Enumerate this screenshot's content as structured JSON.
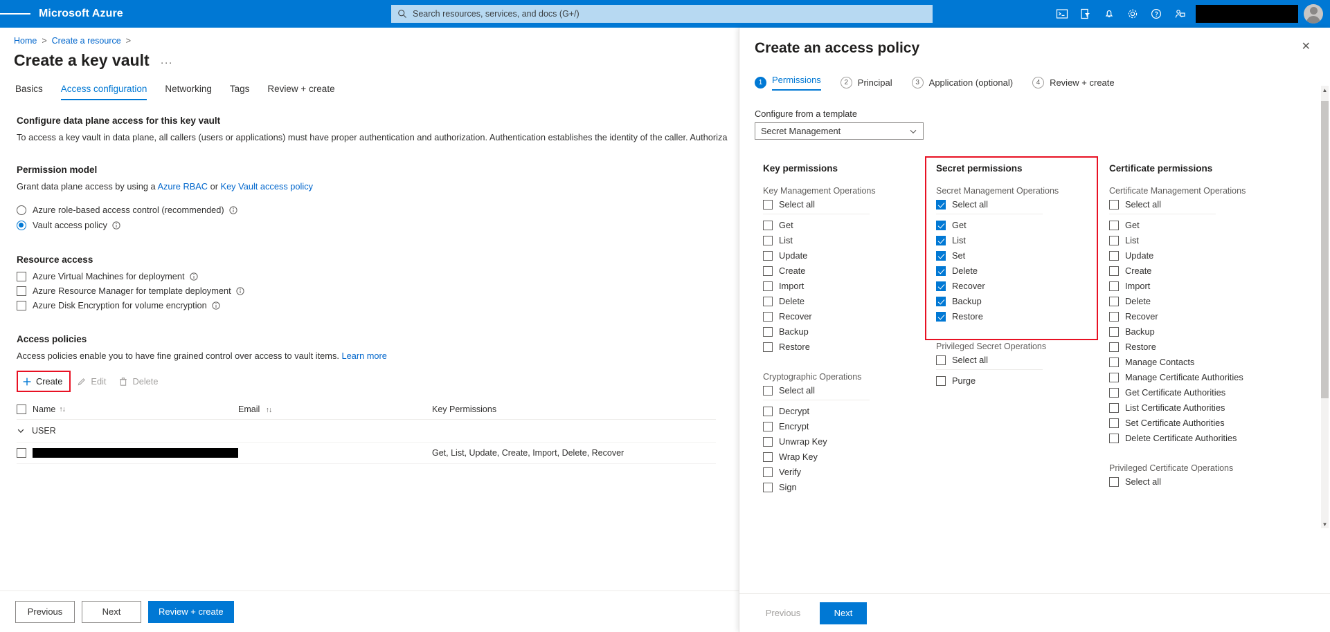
{
  "topbar": {
    "brand": "Microsoft Azure",
    "search_placeholder": "Search resources, services, and docs (G+/)",
    "icons": [
      {
        "name": "cloud-shell-icon"
      },
      {
        "name": "directory-filter-icon"
      },
      {
        "name": "notifications-bell-icon"
      },
      {
        "name": "settings-gear-icon"
      },
      {
        "name": "help-question-icon"
      },
      {
        "name": "feedback-smiley-icon"
      }
    ]
  },
  "breadcrumb": {
    "home": "Home",
    "create_resource": "Create a resource",
    "separator": ">"
  },
  "page": {
    "title": "Create a key vault",
    "ellipsis": "···"
  },
  "tabs": [
    {
      "label": "Basics",
      "active": false
    },
    {
      "label": "Access configuration",
      "active": true
    },
    {
      "label": "Networking",
      "active": false
    },
    {
      "label": "Tags",
      "active": false
    },
    {
      "label": "Review + create",
      "active": false
    }
  ],
  "main": {
    "configure_heading": "Configure data plane access for this key vault",
    "configure_desc": "To access a key vault in data plane, all callers (users or applications) must have proper authentication and authorization. Authentication establishes the identity of the caller. Authoriza",
    "permission_model": {
      "heading": "Permission model",
      "desc_prefix": "Grant data plane access by using a",
      "link_rbac": "Azure RBAC",
      "desc_mid": "or",
      "link_policy": "Key Vault access policy",
      "options": [
        {
          "label": "Azure role-based access control (recommended)",
          "selected": false
        },
        {
          "label": "Vault access policy",
          "selected": true
        }
      ]
    },
    "resource_access": {
      "heading": "Resource access",
      "items": [
        {
          "label": "Azure Virtual Machines for deployment",
          "checked": false
        },
        {
          "label": "Azure Resource Manager for template deployment",
          "checked": false
        },
        {
          "label": "Azure Disk Encryption for volume encryption",
          "checked": false
        }
      ]
    },
    "access_policies": {
      "heading": "Access policies",
      "desc": "Access policies enable you to have fine grained control over access to vault items.",
      "learn_more": "Learn more",
      "toolbar": {
        "create": "Create",
        "edit": "Edit",
        "delete": "Delete"
      },
      "table": {
        "headers": {
          "name": "Name",
          "email": "Email",
          "key_permissions": "Key Permissions"
        },
        "group_label": "USER",
        "rows": [
          {
            "name_redacted": true,
            "email": "",
            "key_permissions": "Get, List, Update, Create, Import, Delete, Recover"
          }
        ]
      }
    }
  },
  "footer": {
    "previous": "Previous",
    "next": "Next",
    "review_create": "Review + create"
  },
  "blade": {
    "title": "Create an access policy",
    "close_label": "✕",
    "steps": [
      {
        "num": "1",
        "label": "Permissions",
        "active": true
      },
      {
        "num": "2",
        "label": "Principal",
        "active": false
      },
      {
        "num": "3",
        "label": "Application (optional)",
        "active": false
      },
      {
        "num": "4",
        "label": "Review + create",
        "active": false
      }
    ],
    "template": {
      "label": "Configure from a template",
      "value": "Secret Management"
    },
    "columns": [
      {
        "title": "Key permissions",
        "highlighted": false,
        "groups": [
          {
            "label": "Key Management Operations",
            "select_all": {
              "label": "Select all",
              "checked": false
            },
            "items": [
              {
                "label": "Get",
                "checked": false
              },
              {
                "label": "List",
                "checked": false
              },
              {
                "label": "Update",
                "checked": false
              },
              {
                "label": "Create",
                "checked": false
              },
              {
                "label": "Import",
                "checked": false
              },
              {
                "label": "Delete",
                "checked": false
              },
              {
                "label": "Recover",
                "checked": false
              },
              {
                "label": "Backup",
                "checked": false
              },
              {
                "label": "Restore",
                "checked": false
              }
            ]
          },
          {
            "label": "Cryptographic Operations",
            "select_all": {
              "label": "Select all",
              "checked": false
            },
            "items": [
              {
                "label": "Decrypt",
                "checked": false
              },
              {
                "label": "Encrypt",
                "checked": false
              },
              {
                "label": "Unwrap Key",
                "checked": false
              },
              {
                "label": "Wrap Key",
                "checked": false
              },
              {
                "label": "Verify",
                "checked": false
              },
              {
                "label": "Sign",
                "checked": false
              }
            ]
          }
        ]
      },
      {
        "title": "Secret permissions",
        "highlighted": true,
        "groups": [
          {
            "label": "Secret Management Operations",
            "select_all": {
              "label": "Select all",
              "checked": true
            },
            "items": [
              {
                "label": "Get",
                "checked": true
              },
              {
                "label": "List",
                "checked": true
              },
              {
                "label": "Set",
                "checked": true
              },
              {
                "label": "Delete",
                "checked": true
              },
              {
                "label": "Recover",
                "checked": true
              },
              {
                "label": "Backup",
                "checked": true
              },
              {
                "label": "Restore",
                "checked": true
              }
            ]
          },
          {
            "label": "Privileged Secret Operations",
            "select_all": {
              "label": "Select all",
              "checked": false
            },
            "items": [
              {
                "label": "Purge",
                "checked": false
              }
            ]
          }
        ]
      },
      {
        "title": "Certificate permissions",
        "highlighted": false,
        "groups": [
          {
            "label": "Certificate Management Operations",
            "select_all": {
              "label": "Select all",
              "checked": false
            },
            "items": [
              {
                "label": "Get",
                "checked": false
              },
              {
                "label": "List",
                "checked": false
              },
              {
                "label": "Update",
                "checked": false
              },
              {
                "label": "Create",
                "checked": false
              },
              {
                "label": "Import",
                "checked": false
              },
              {
                "label": "Delete",
                "checked": false
              },
              {
                "label": "Recover",
                "checked": false
              },
              {
                "label": "Backup",
                "checked": false
              },
              {
                "label": "Restore",
                "checked": false
              },
              {
                "label": "Manage Contacts",
                "checked": false
              },
              {
                "label": "Manage Certificate Authorities",
                "checked": false
              },
              {
                "label": "Get Certificate Authorities",
                "checked": false
              },
              {
                "label": "List Certificate Authorities",
                "checked": false
              },
              {
                "label": "Set Certificate Authorities",
                "checked": false
              },
              {
                "label": "Delete Certificate Authorities",
                "checked": false
              }
            ]
          },
          {
            "label": "Privileged Certificate Operations",
            "select_all": {
              "label": "Select all",
              "checked": false
            },
            "items": []
          }
        ]
      }
    ],
    "footer": {
      "previous": "Previous",
      "next": "Next"
    }
  },
  "colors": {
    "azure_blue": "#0078d4",
    "highlight_red": "#e81123",
    "link_blue": "#0066cc"
  }
}
